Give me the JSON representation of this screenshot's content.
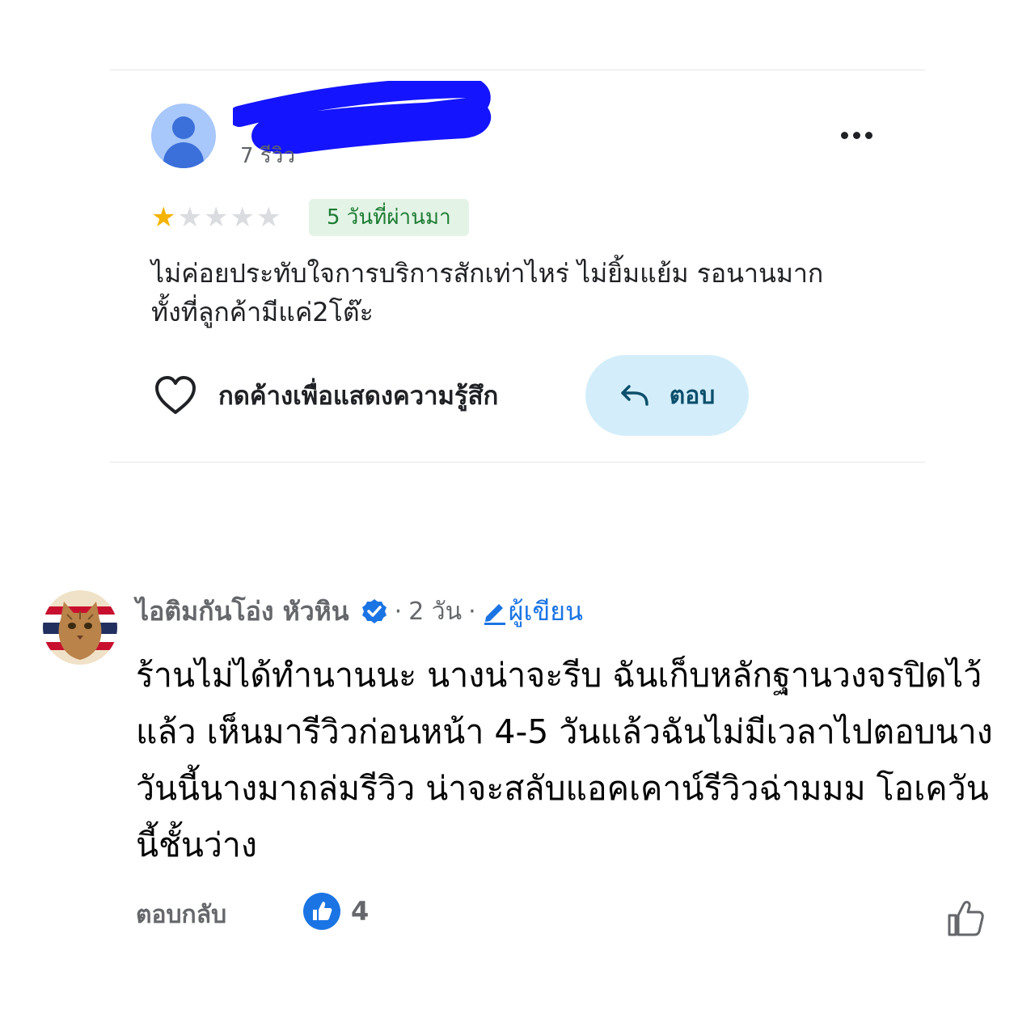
{
  "review": {
    "reviewer_review_count": "7 รีวิว",
    "rating": 1,
    "rating_max": 5,
    "time_badge": "5 วันที่ผ่านมา",
    "text_line1": "ไม่ค่อยประทับใจการบริการสักเท่าไหร่  ไม่ยิ้มแย้ม รอนานมาก",
    "text_line2": "ทั้งที่ลูกค้ามีแค่2โต๊ะ",
    "react_label": "กดค้างเพื่อแสดงความรู้สึก",
    "reply_label": "ตอบ",
    "colors": {
      "star_filled": "#f4b400",
      "star_empty": "#dadce0",
      "badge_bg": "#e3f4e6",
      "reply_bg": "#d3eefa"
    }
  },
  "comment": {
    "author": "ไอติมกันโอ่ง หัวหิน",
    "separator": "·",
    "time": "2 วัน",
    "author_badge": "ผู้เขียน",
    "text": "ร้านไม่ได้ทำนานนะ นางน่าจะรีบ ฉันเก็บหลักฐานวงจรปิดไว้แล้ว เห็นมารีวิวก่อนหน้า 4-5 วันแล้วฉันไม่มีเวลาไปตอบนาง วันนี้นางมาถล่มรีวิว น่าจะสลับแอคเคาน์รีวิวฉ่ามมม โอเควันนี้ชั้นว่าง",
    "reply_label": "ตอบกลับ",
    "like_count": "4",
    "colors": {
      "accent": "#1b74e4",
      "muted": "#65676b"
    }
  }
}
